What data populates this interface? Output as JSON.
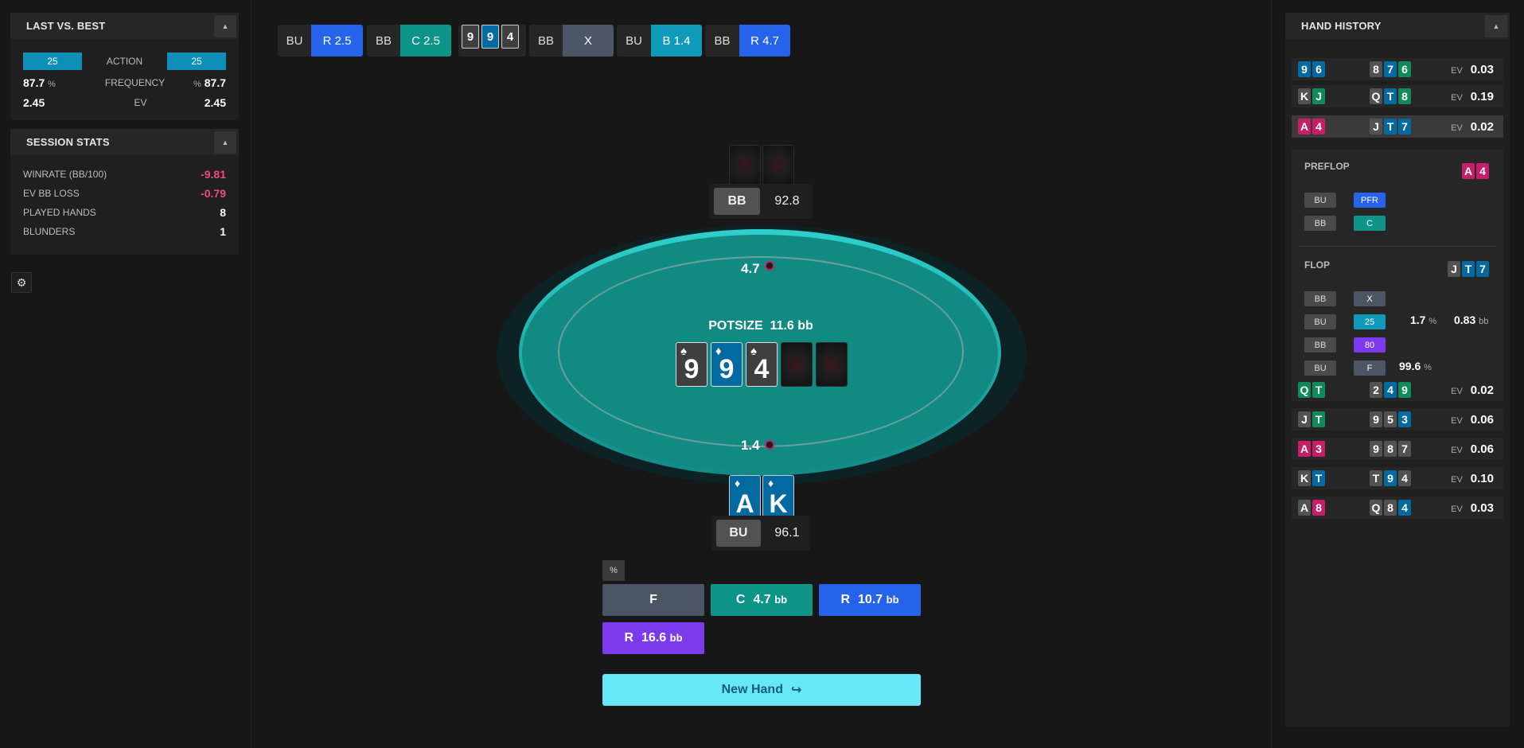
{
  "last_vs_best": {
    "title": "LAST VS. BEST",
    "collapse_icon": "▲",
    "action_label": "ACTION",
    "action_left": "25",
    "action_right": "25",
    "frequency_label": "FREQUENCY",
    "freq_left": "87.7",
    "freq_right": "87.7",
    "percent": "%",
    "ev_label": "EV",
    "ev_left": "2.45",
    "ev_right": "2.45"
  },
  "session_stats": {
    "title": "SESSION STATS",
    "collapse_icon": "▲",
    "winrate_label": "WINRATE (BB/100)",
    "winrate": "-9.81",
    "ev_loss_label": "EV BB LOSS",
    "ev_loss": "-0.79",
    "played_label": "PLAYED HANDS",
    "played": "8",
    "blunders_label": "BLUNDERS",
    "blunders": "1"
  },
  "settings_icon": "⚙",
  "action_strip": [
    {
      "pos": "BU",
      "action": "R 2.5",
      "color": "#2563eb"
    },
    {
      "pos": "BB",
      "action": "C 2.5",
      "color": "#0d9488"
    },
    {
      "board": [
        "9",
        "9",
        "4"
      ]
    },
    {
      "pos": "BB",
      "action": "X",
      "color": "#4b5563"
    },
    {
      "pos": "BU",
      "action": "B 1.4",
      "color": "#0e9ab8"
    },
    {
      "pos": "BB",
      "action": "R 4.7",
      "color": "#2563eb"
    }
  ],
  "table": {
    "top_bet": "4.7",
    "bottom_bet": "1.4",
    "potsize_label": "POTSIZE",
    "potsize_value": "11.6 bb",
    "board": [
      {
        "rank": "9",
        "suit": "♠",
        "color": "gray"
      },
      {
        "rank": "9",
        "suit": "♦",
        "color": "blue"
      },
      {
        "rank": "4",
        "suit": "♠",
        "color": "gray"
      }
    ],
    "villain": {
      "pos": "BB",
      "stack": "92.8"
    },
    "hero": {
      "pos": "BU",
      "stack": "96.1",
      "cards": [
        {
          "rank": "A",
          "suit": "♦"
        },
        {
          "rank": "K",
          "suit": "♦"
        }
      ]
    }
  },
  "actions": {
    "pct_toggle": "%",
    "fold": {
      "label": "F",
      "color": "#4b5563"
    },
    "call": {
      "label": "C",
      "amount": "4.7",
      "unit": "bb",
      "color": "#0d9488"
    },
    "raise1": {
      "label": "R",
      "amount": "10.7",
      "unit": "bb",
      "color": "#2563eb"
    },
    "raise2": {
      "label": "R",
      "amount": "16.6",
      "unit": "bb",
      "color": "#7c3aed"
    },
    "new_hand": "New Hand",
    "new_hand_icon": "↪"
  },
  "hand_history": {
    "title": "HAND HISTORY",
    "collapse_icon": "▲",
    "ev_label": "EV",
    "rows": [
      {
        "hand": [
          [
            "9",
            "blue"
          ],
          [
            "6",
            "blue"
          ]
        ],
        "board": [
          [
            "8",
            "gray"
          ],
          [
            "7",
            "blue"
          ],
          [
            "6",
            "green"
          ]
        ],
        "ev": "0.03"
      },
      {
        "hand": [
          [
            "K",
            "gray"
          ],
          [
            "J",
            "green"
          ]
        ],
        "board": [
          [
            "Q",
            "gray"
          ],
          [
            "T",
            "blue"
          ],
          [
            "8",
            "green"
          ]
        ],
        "ev": "0.19"
      },
      {
        "hand": [
          [
            "A",
            "pink"
          ],
          [
            "4",
            "pink"
          ]
        ],
        "board": [
          [
            "J",
            "gray"
          ],
          [
            "T",
            "blue"
          ],
          [
            "7",
            "blue"
          ]
        ],
        "ev": "0.02"
      },
      {
        "hand": [
          [
            "Q",
            "green"
          ],
          [
            "T",
            "green"
          ]
        ],
        "board": [
          [
            "2",
            "gray"
          ],
          [
            "4",
            "blue"
          ],
          [
            "9",
            "green"
          ]
        ],
        "ev": "0.02"
      },
      {
        "hand": [
          [
            "J",
            "gray"
          ],
          [
            "T",
            "green"
          ]
        ],
        "board": [
          [
            "9",
            "gray"
          ],
          [
            "5",
            "gray"
          ],
          [
            "3",
            "blue"
          ]
        ],
        "ev": "0.06"
      },
      {
        "hand": [
          [
            "A",
            "pink"
          ],
          [
            "3",
            "pink"
          ]
        ],
        "board": [
          [
            "9",
            "gray"
          ],
          [
            "8",
            "gray"
          ],
          [
            "7",
            "gray"
          ]
        ],
        "ev": "0.06"
      },
      {
        "hand": [
          [
            "K",
            "gray"
          ],
          [
            "T",
            "blue"
          ]
        ],
        "board": [
          [
            "T",
            "gray"
          ],
          [
            "9",
            "blue"
          ],
          [
            "4",
            "gray"
          ]
        ],
        "ev": "0.10"
      },
      {
        "hand": [
          [
            "A",
            "gray"
          ],
          [
            "8",
            "pink"
          ]
        ],
        "board": [
          [
            "Q",
            "gray"
          ],
          [
            "8",
            "gray"
          ],
          [
            "4",
            "blue"
          ]
        ],
        "ev": "0.03"
      }
    ],
    "detail": {
      "preflop_label": "PREFLOP",
      "preflop_cards": [
        [
          "A",
          "pink"
        ],
        [
          "4",
          "pink"
        ]
      ],
      "preflop_actions": [
        {
          "pos": "BU",
          "act": "PFR",
          "color": "#2563eb"
        },
        {
          "pos": "BB",
          "act": "C",
          "color": "#0d9488"
        }
      ],
      "flop_label": "FLOP",
      "flop_cards": [
        [
          "J",
          "gray"
        ],
        [
          "T",
          "blue"
        ],
        [
          "7",
          "blue"
        ]
      ],
      "flop_actions": [
        {
          "pos": "BB",
          "act": "X",
          "color": "#4b5563"
        },
        {
          "pos": "BU",
          "act": "25",
          "color": "#0e9ab8",
          "freq": "1.7",
          "freq_unit": "%",
          "bb": "0.83",
          "bb_unit": "bb"
        },
        {
          "pos": "BB",
          "act": "80",
          "color": "#7c3aed"
        },
        {
          "pos": "BU",
          "act": "F",
          "color": "#4b5563",
          "freq": "99.6",
          "freq_unit": "%"
        }
      ]
    }
  }
}
